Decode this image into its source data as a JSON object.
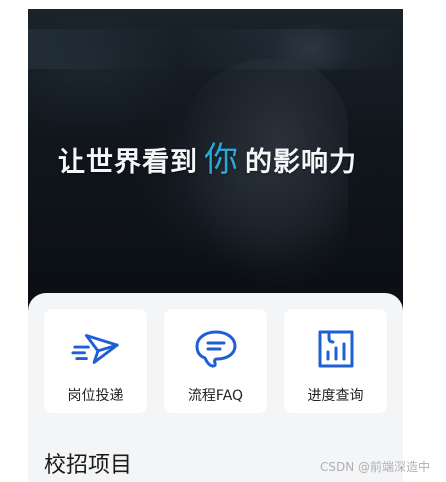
{
  "banner": {
    "slogan_before": "让世界看到",
    "slogan_accent": "你",
    "slogan_after": "的影响力"
  },
  "quick_actions": [
    {
      "label": "岗位投递",
      "icon": "paper-plane-icon"
    },
    {
      "label": "流程FAQ",
      "icon": "chat-bubble-icon"
    },
    {
      "label": "进度查询",
      "icon": "chart-document-icon"
    }
  ],
  "section": {
    "title": "校招项目"
  },
  "watermark": "CSDN @前端深造中",
  "colors": {
    "icon_blue": "#1f5fd6",
    "accent": "#2aa6d8"
  }
}
